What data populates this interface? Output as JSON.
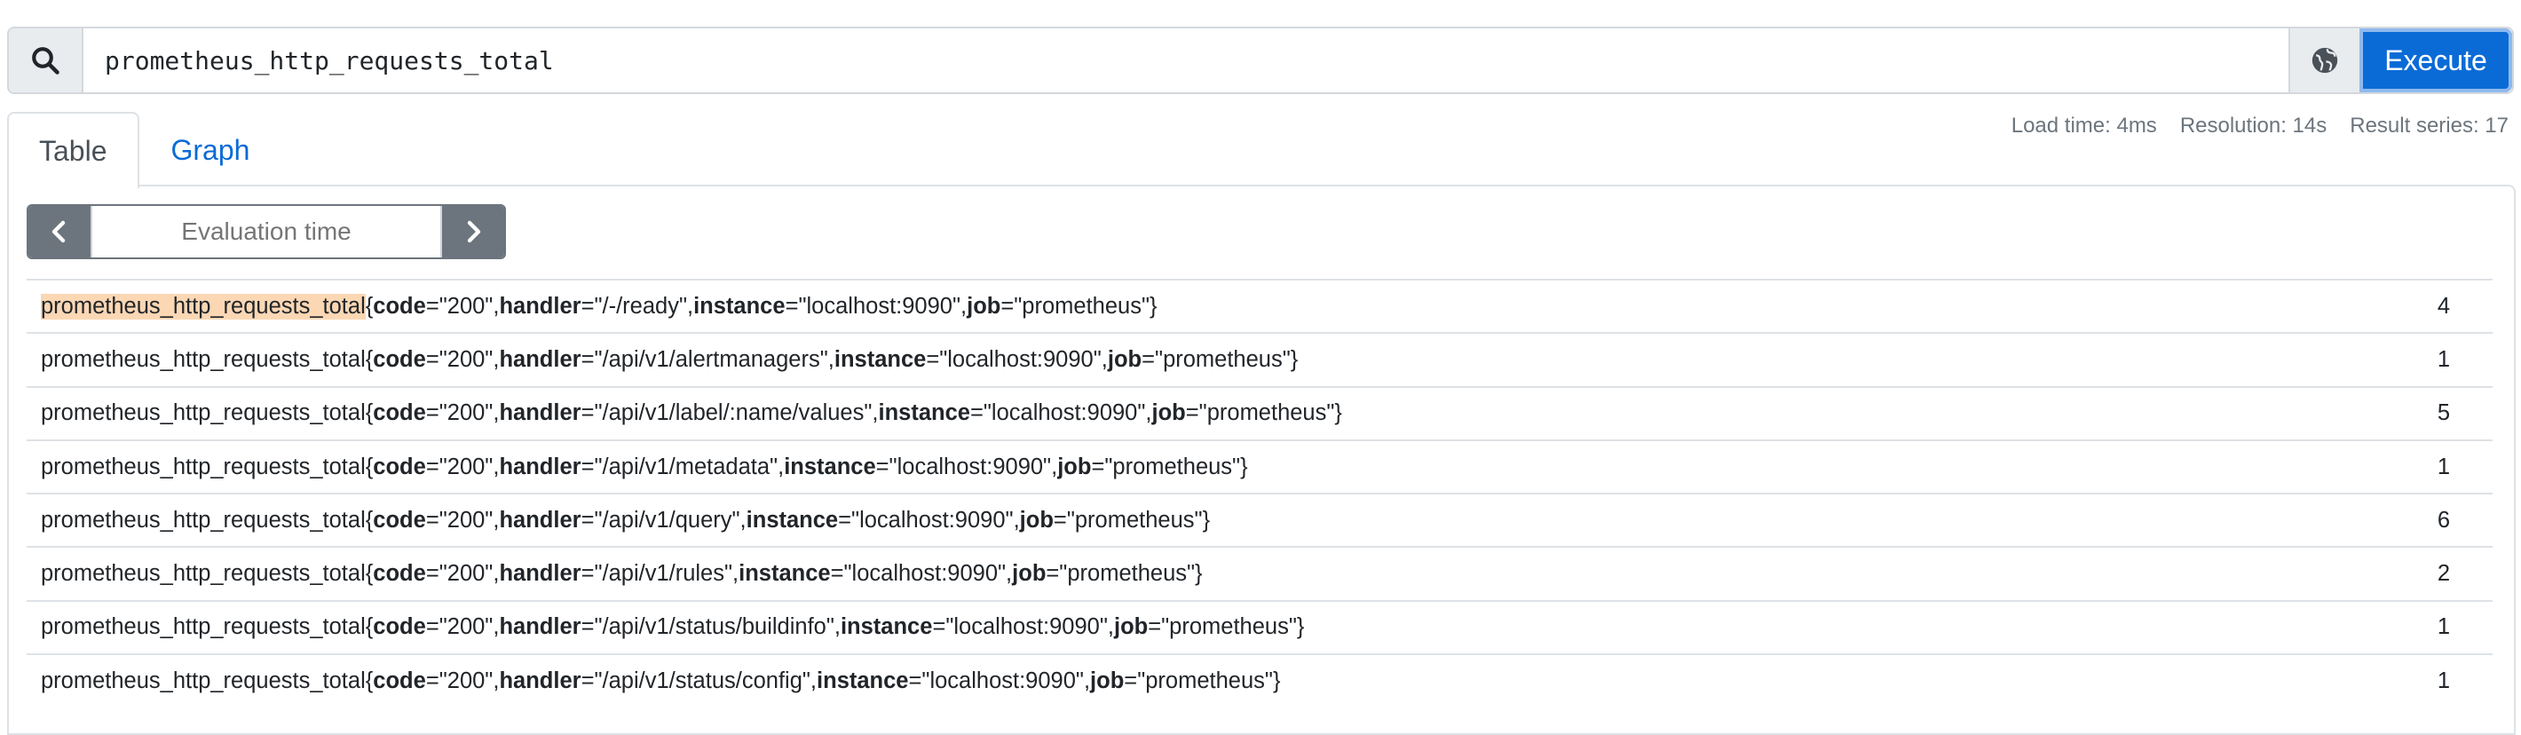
{
  "query": {
    "value": "prometheus_http_requests_total",
    "execute_label": "Execute"
  },
  "stats": {
    "load_time": "Load time: 4ms",
    "resolution": "Resolution: 14s",
    "result_series": "Result series: 17"
  },
  "tabs": [
    {
      "label": "Table",
      "active": true
    },
    {
      "label": "Graph",
      "active": false
    }
  ],
  "eval_time": {
    "placeholder": "Evaluation time"
  },
  "colors": {
    "accent": "#0b6bd6",
    "highlight": "#fbd7b4",
    "nav_gray": "#6c757d"
  },
  "rows": [
    {
      "metric": "prometheus_http_requests_total",
      "open": "{",
      "k1": "code",
      "v1": "=\"200\", ",
      "k2": "handler",
      "v2": "=\"/-/ready\", ",
      "k3": "instance",
      "v3": "=\"localhost:9090\", ",
      "k4": "job",
      "v4": "=\"prometheus\"}",
      "value": "4"
    },
    {
      "metric": "prometheus_http_requests_total",
      "open": "{",
      "k1": "code",
      "v1": "=\"200\", ",
      "k2": "handler",
      "v2": "=\"/api/v1/alertmanagers\", ",
      "k3": "instance",
      "v3": "=\"localhost:9090\", ",
      "k4": "job",
      "v4": "=\"prometheus\"}",
      "value": "1"
    },
    {
      "metric": "prometheus_http_requests_total",
      "open": "{",
      "k1": "code",
      "v1": "=\"200\", ",
      "k2": "handler",
      "v2": "=\"/api/v1/label/:name/values\", ",
      "k3": "instance",
      "v3": "=\"localhost:9090\", ",
      "k4": "job",
      "v4": "=\"prometheus\"}",
      "value": "5"
    },
    {
      "metric": "prometheus_http_requests_total",
      "open": "{",
      "k1": "code",
      "v1": "=\"200\", ",
      "k2": "handler",
      "v2": "=\"/api/v1/metadata\", ",
      "k3": "instance",
      "v3": "=\"localhost:9090\", ",
      "k4": "job",
      "v4": "=\"prometheus\"}",
      "value": "1"
    },
    {
      "metric": "prometheus_http_requests_total",
      "open": "{",
      "k1": "code",
      "v1": "=\"200\", ",
      "k2": "handler",
      "v2": "=\"/api/v1/query\", ",
      "k3": "instance",
      "v3": "=\"localhost:9090\", ",
      "k4": "job",
      "v4": "=\"prometheus\"}",
      "value": "6"
    },
    {
      "metric": "prometheus_http_requests_total",
      "open": "{",
      "k1": "code",
      "v1": "=\"200\", ",
      "k2": "handler",
      "v2": "=\"/api/v1/rules\", ",
      "k3": "instance",
      "v3": "=\"localhost:9090\", ",
      "k4": "job",
      "v4": "=\"prometheus\"}",
      "value": "2"
    },
    {
      "metric": "prometheus_http_requests_total",
      "open": "{",
      "k1": "code",
      "v1": "=\"200\", ",
      "k2": "handler",
      "v2": "=\"/api/v1/status/buildinfo\", ",
      "k3": "instance",
      "v3": "=\"localhost:9090\", ",
      "k4": "job",
      "v4": "=\"prometheus\"}",
      "value": "1"
    },
    {
      "metric": "prometheus_http_requests_total",
      "open": "{",
      "k1": "code",
      "v1": "=\"200\", ",
      "k2": "handler",
      "v2": "=\"/api/v1/status/config\", ",
      "k3": "instance",
      "v3": "=\"localhost:9090\", ",
      "k4": "job",
      "v4": "=\"prometheus\"}",
      "value": "1"
    }
  ]
}
